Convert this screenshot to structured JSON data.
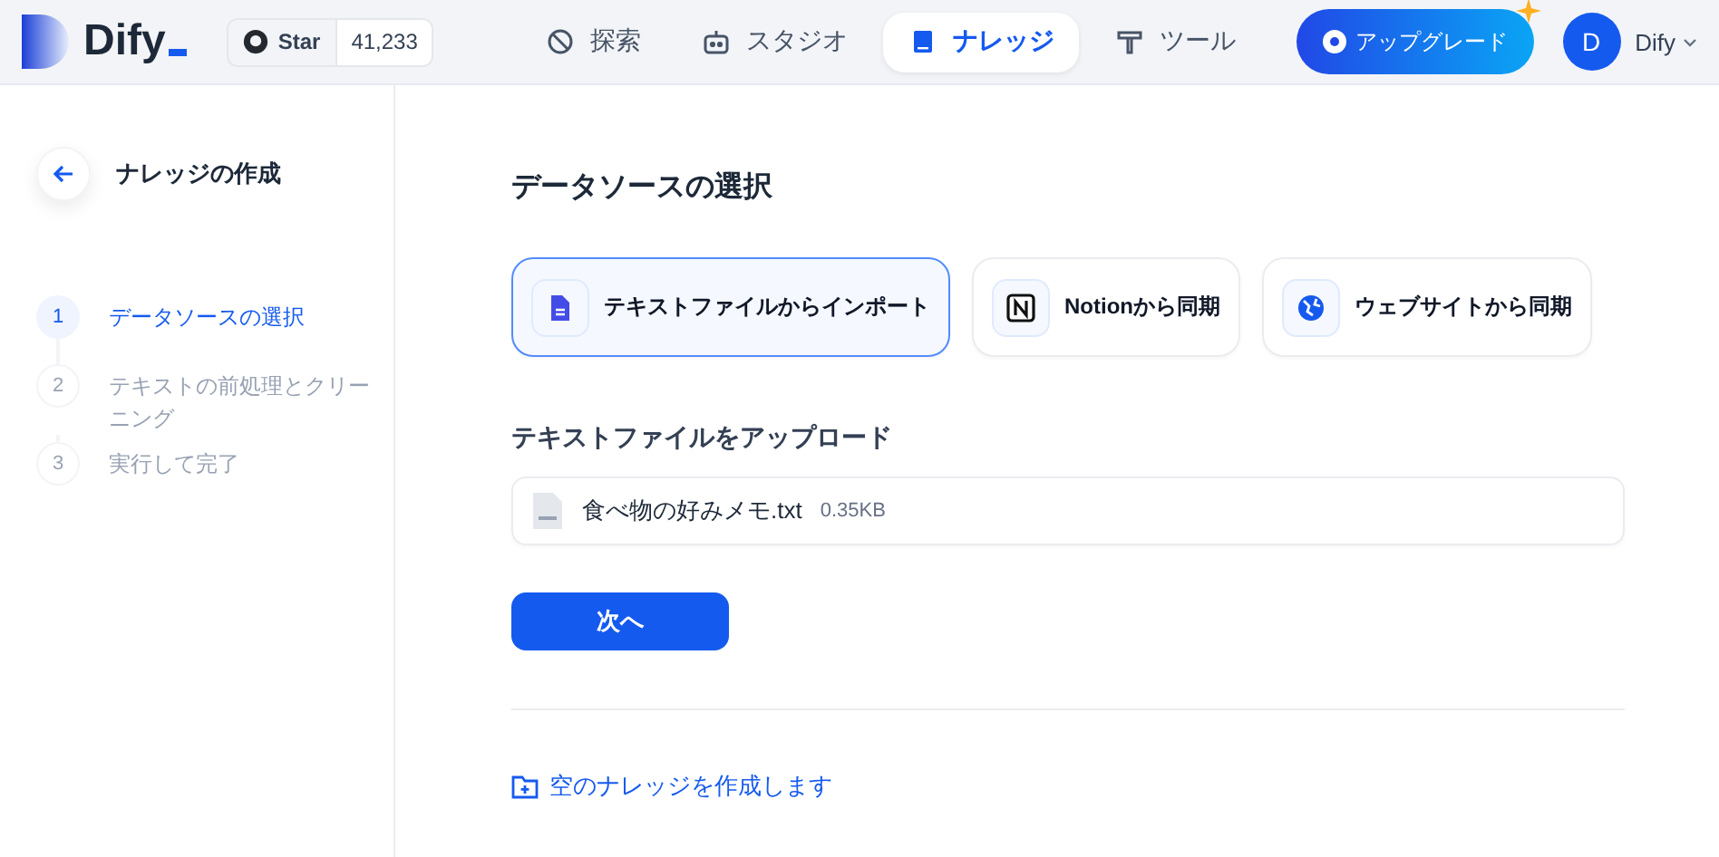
{
  "header": {
    "logo": "Dify",
    "github": {
      "label": "Star",
      "count": "41,233"
    },
    "nav": [
      {
        "label": "探索",
        "selected": false
      },
      {
        "label": "スタジオ",
        "selected": false
      },
      {
        "label": "ナレッジ",
        "selected": true
      },
      {
        "label": "ツール",
        "selected": false
      }
    ],
    "upgrade": "アップグレード",
    "avatar": "D",
    "user": "Dify"
  },
  "sidebar": {
    "title": "ナレッジの作成",
    "steps": [
      {
        "number": "1",
        "label": "データソースの選択",
        "selected": true
      },
      {
        "number": "2",
        "label": "テキストの前処理とクリーニング",
        "selected": false
      },
      {
        "number": "3",
        "label": "実行して完了",
        "selected": false
      }
    ]
  },
  "main": {
    "title": "データソースの選択",
    "sources": [
      {
        "kind": "file",
        "label": "テキストファイルからインポート",
        "selected": true
      },
      {
        "kind": "notion",
        "label": "Notionから同期",
        "selected": false
      },
      {
        "kind": "web",
        "label": "ウェブサイトから同期",
        "selected": false
      }
    ],
    "upload_title": "テキストファイルをアップロード",
    "files": [
      {
        "name": "食べ物の好みメモ.txt",
        "size": "0.35KB"
      }
    ],
    "next": "次へ",
    "empty_link": "空のナレッジを作成します"
  }
}
